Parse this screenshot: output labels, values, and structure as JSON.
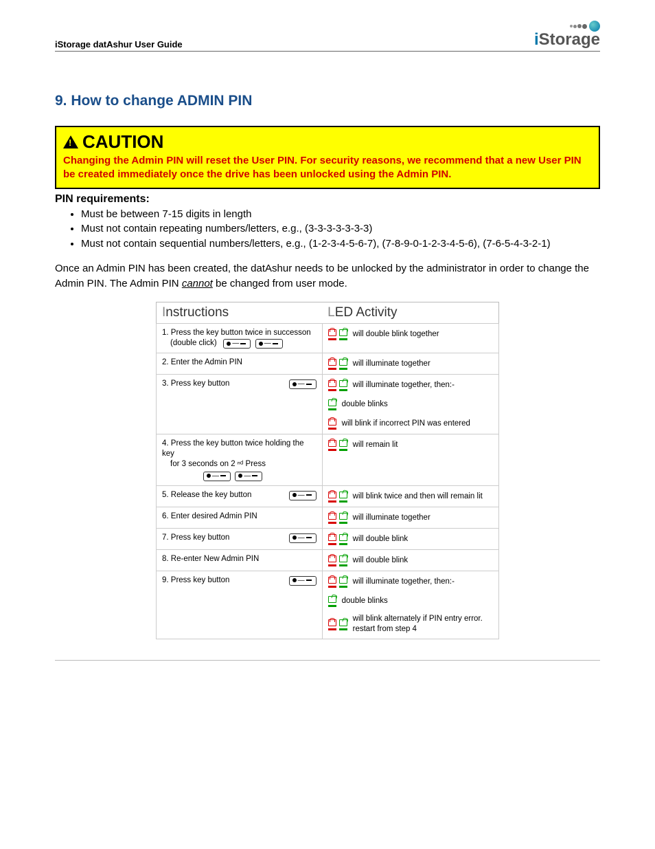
{
  "header": {
    "title": "iStorage datAshur User Guide",
    "logo": "iStorage"
  },
  "section": {
    "number": "9.",
    "title": "How to change ADMIN PIN"
  },
  "caution": {
    "label": "CAUTION",
    "body": "Changing the Admin PIN will reset the User PIN.  For security reasons, we recommend that a new User PIN be created immediately once the drive has been unlocked using the Admin PIN."
  },
  "pin_req": {
    "title": "PIN requirements:",
    "items": [
      "Must be between 7-15 digits in length",
      "Must not contain repeating numbers/letters, e.g., (3-3-3-3-3-3-3)",
      "Must not contain sequential numbers/letters, e.g., (1-2-3-4-5-6-7), (7-8-9-0-1-2-3-4-5-6), (7-6-5-4-3-2-1)"
    ]
  },
  "para": {
    "pre": "Once an Admin PIN has been created, the datAshur needs to be unlocked by the administrator in order to change the Admin PIN.  The Admin PIN ",
    "cannot": "cannot",
    "post": "  be changed from user mode."
  },
  "table": {
    "col1": "Instructions",
    "col2": "LED Activity",
    "rows": [
      {
        "instr": "1. Press the key button twice in successon",
        "instr_sub": "(double click)",
        "keys": 2,
        "leds": [
          {
            "icons": [
              "red",
              "green-open"
            ],
            "text": "will double blink together"
          }
        ]
      },
      {
        "instr": "2. Enter the Admin PIN",
        "keys": 0,
        "leds": [
          {
            "icons": [
              "red",
              "green-open"
            ],
            "text": "will illuminate together"
          }
        ]
      },
      {
        "instr": "3.  Press key button",
        "keys": 1,
        "leds": [
          {
            "icons": [
              "red",
              "green-open"
            ],
            "text": "will illuminate together, then:-"
          },
          {
            "icons": [
              "green-open"
            ],
            "text": "double blinks"
          },
          {
            "icons": [
              "red"
            ],
            "text": "will blink if incorrect PIN was entered"
          }
        ]
      },
      {
        "instr": "4. Press the key button  twice holding the key",
        "instr_sub": "for 3 seconds on 2 ⁿᵈ Press",
        "keys": 2,
        "keys_below": true,
        "leds": [
          {
            "icons": [
              "red",
              "green-open"
            ],
            "text": "will remain lit"
          }
        ]
      },
      {
        "instr": "5. Release the key button",
        "keys": 1,
        "leds": [
          {
            "icons": [
              "red",
              "green-open"
            ],
            "text": "will blink twice and then will remain lit"
          }
        ]
      },
      {
        "instr": "6. Enter desired Admin PIN",
        "keys": 0,
        "leds": [
          {
            "icons": [
              "red",
              "green-open"
            ],
            "text": "will illuminate together"
          }
        ]
      },
      {
        "instr": "7. Press key button",
        "keys": 1,
        "leds": [
          {
            "icons": [
              "red",
              "green-open"
            ],
            "text": "will double blink"
          }
        ]
      },
      {
        "instr": "8. Re-enter New Admin PIN",
        "keys": 0,
        "leds": [
          {
            "icons": [
              "red",
              "green-open"
            ],
            "text": "will double blink"
          }
        ]
      },
      {
        "instr": "9.  Press key button",
        "keys": 1,
        "leds": [
          {
            "icons": [
              "red",
              "green-open"
            ],
            "text": "will illuminate together, then:-"
          },
          {
            "icons": [
              "green-open"
            ],
            "text": "double blinks"
          },
          {
            "icons": [
              "red",
              "green-open"
            ],
            "text": "will blink alternately if PIN entry error. restart from step 4"
          }
        ]
      }
    ]
  }
}
